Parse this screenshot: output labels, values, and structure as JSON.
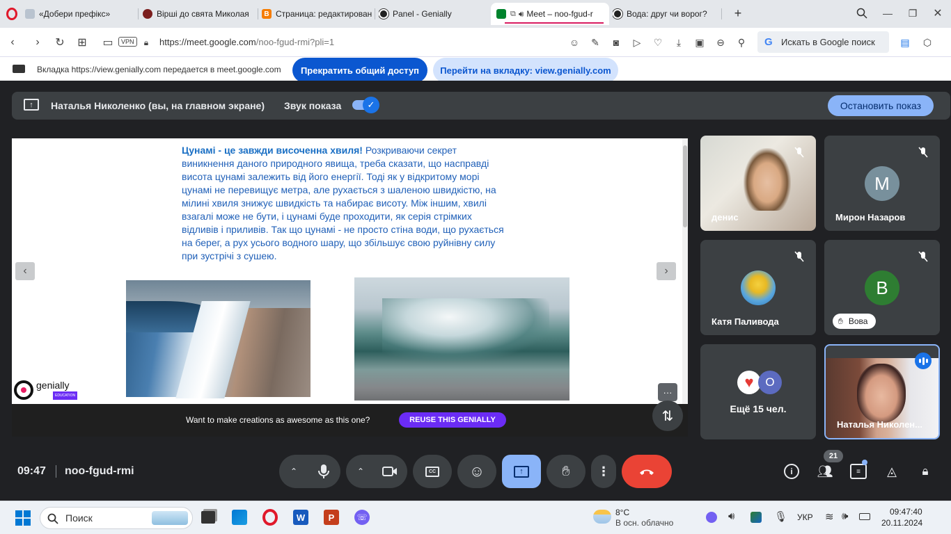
{
  "tabs": [
    {
      "label": "«Добери префікс»"
    },
    {
      "label": "Вірші до свята Миколая"
    },
    {
      "label": "Страница: редактирован"
    },
    {
      "label": "Panel - Genially"
    },
    {
      "label": "Meet – noo-fgud-r"
    },
    {
      "label": "Вода: друг чи ворог?"
    }
  ],
  "address_bar": {
    "vpn": "VPN",
    "url_host": "https://meet.google.com",
    "url_path": "/noo-fgud-rmi?pli=1",
    "search_placeholder": "Искать в Google поиск"
  },
  "share_bar": {
    "message": "Вкладка https://view.genially.com передается в meet.google.com",
    "stop_label": "Прекратить общий доступ",
    "goto_label": "Перейти на вкладку: view.genially.com"
  },
  "presenting": {
    "presenter": "Наталья Николенко (вы, на главном экране)",
    "sound_label": "Звук показа",
    "stop_label": "Остановить показ"
  },
  "slide": {
    "bold_text": "Цунамі - це завжди височенна хвиля!",
    "body_text": " Розкриваючи секрет виникнення даного природного явища, треба сказати, що насправді висота цунамі залежить від його енергії. Тоді як у відкритому морі цунамі не перевищує метра, але рухається з шаленою швидкістю, на мілині хвиля знижує швидкість та набирає висоту. Між іншим, хвилі взагалі може не бути, і цунамі буде проходити, як серія стрімких відливів і приливів. Так що цунамі - не просто стіна води, що рухається на берег, а рух усього водного шару, що збільшує свою руйнівну силу при зустрічі з сушею.",
    "logo_text": "genially",
    "logo_sub": "EDUCATION",
    "banner_text": "Want to make creations as awesome as this one?",
    "reuse_label": "REUSE THIS GENIALLY",
    "more_label": "···"
  },
  "participants": [
    {
      "name": "денис",
      "muted": true
    },
    {
      "name": "Мирон Назаров",
      "initial": "М",
      "muted": true
    },
    {
      "name": "Катя Паливода",
      "muted": true
    },
    {
      "name": "Вова",
      "initial": "В",
      "muted": true
    },
    {
      "name": "Ещё 15 чел.",
      "extra_initial": "О"
    },
    {
      "name": "Наталья Николен..."
    }
  ],
  "bottom": {
    "time": "09:47",
    "meeting_code": "noo-fgud-rmi",
    "participants_count": "21"
  },
  "taskbar": {
    "search_placeholder": "Поиск",
    "weather_temp": "8°C",
    "weather_desc": "В осн. облачно",
    "lang": "УКР",
    "clock_time": "09:47:40",
    "clock_date": "20.11.2024"
  },
  "colors": {
    "accent_blue": "#1a73e8",
    "stop_pill": "#aecbfa",
    "end_call": "#ea4335",
    "reuse_purple": "#6b2cf5"
  }
}
